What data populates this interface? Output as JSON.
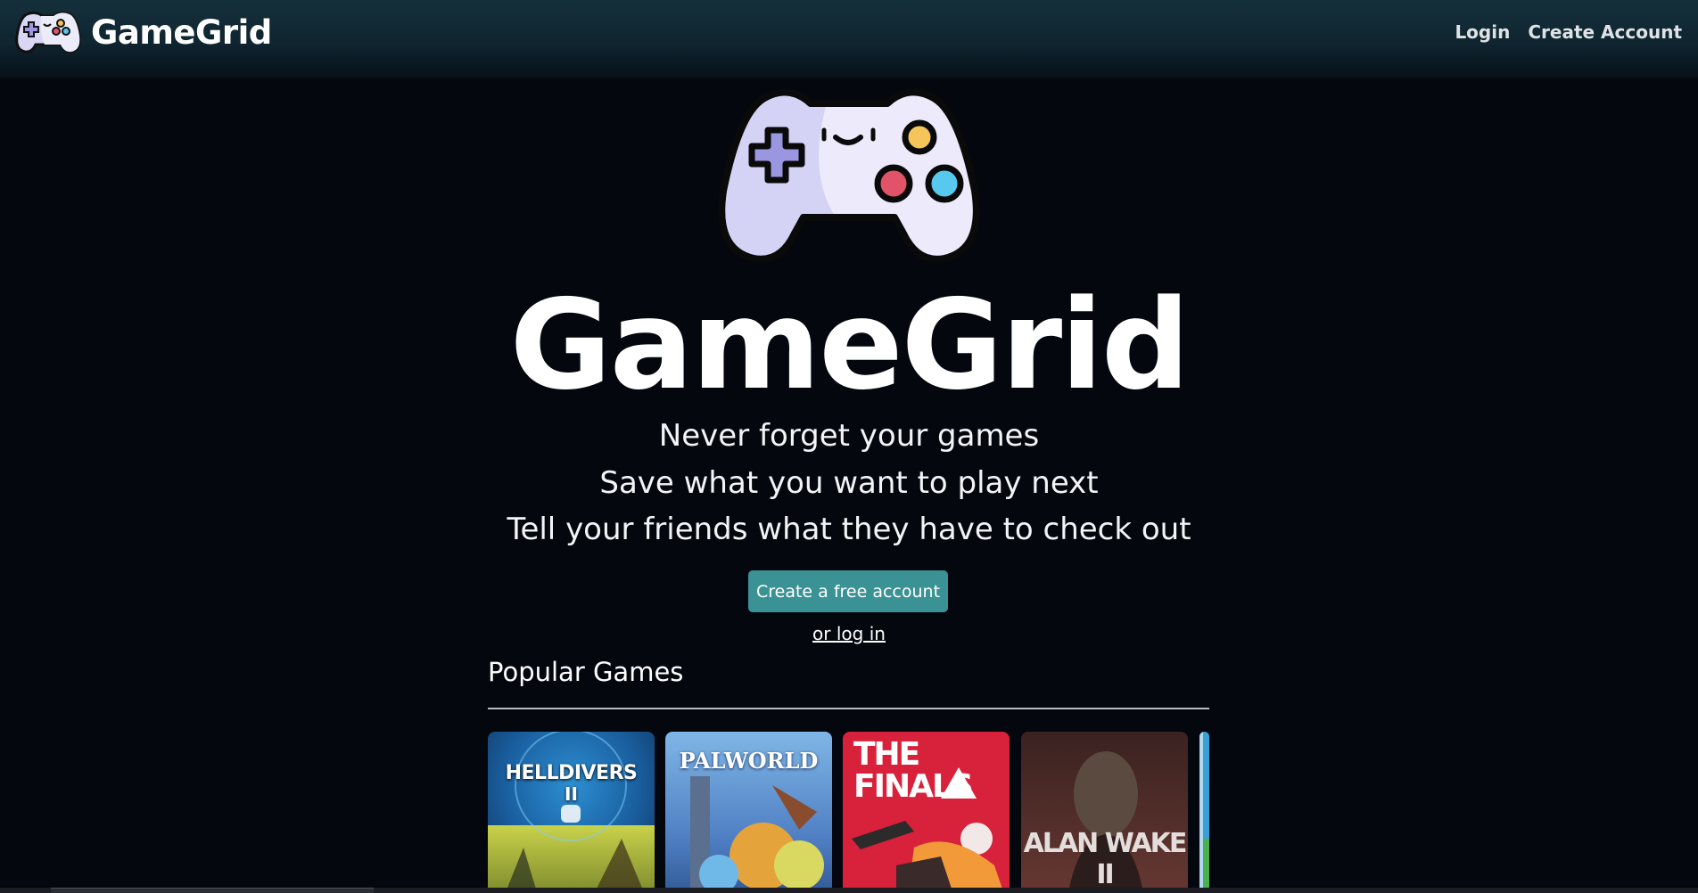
{
  "navbar": {
    "brand_name": "GameGrid",
    "login_label": "Login",
    "create_account_label": "Create Account"
  },
  "hero": {
    "title": "GameGrid",
    "taglines": [
      "Never forget your games",
      "Save what you want to play next",
      "Tell your friends what they have to check out"
    ],
    "cta_label": "Create a free account",
    "or_text": "or",
    "login_link": "log in"
  },
  "popular": {
    "title": "Popular Games",
    "games": [
      {
        "name": "HELLDIVERS",
        "subtitle": "II"
      },
      {
        "name": "PALWORLD"
      },
      {
        "name": "THE",
        "name2": "FINALS"
      },
      {
        "name": "ALAN WAKE II"
      }
    ]
  },
  "colors": {
    "accent": "#3b9294",
    "background": "#05070e",
    "navbar": "#15303b"
  },
  "icons": {
    "brand": "gamepad-icon",
    "hero": "gamepad-icon"
  }
}
